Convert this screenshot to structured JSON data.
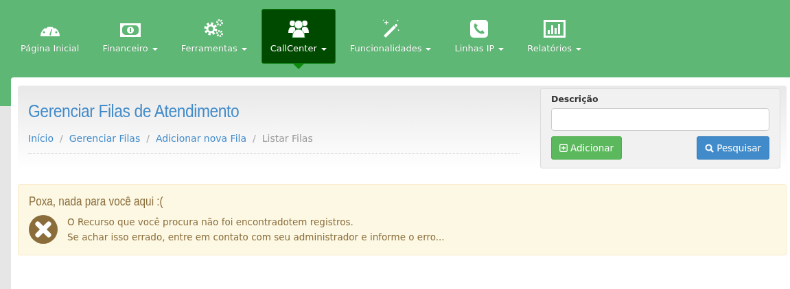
{
  "nav": {
    "items": [
      {
        "label": "Página Inicial",
        "dropdown": false,
        "selected": false
      },
      {
        "label": "Financeiro",
        "dropdown": true,
        "selected": false
      },
      {
        "label": "Ferramentas",
        "dropdown": true,
        "selected": false
      },
      {
        "label": "CallCenter",
        "dropdown": true,
        "selected": true
      },
      {
        "label": "Funcionalidades",
        "dropdown": true,
        "selected": false
      },
      {
        "label": "Linhas IP",
        "dropdown": true,
        "selected": false
      },
      {
        "label": "Relatórios",
        "dropdown": true,
        "selected": false
      }
    ]
  },
  "page": {
    "title": "Gerenciar Filas de Atendimento",
    "breadcrumb": [
      {
        "label": "Início",
        "current": false
      },
      {
        "separator": "/",
        "label": "Gerenciar Filas",
        "current": false
      },
      {
        "separator": "/",
        "label": "Adicionar nova Fila",
        "current": false
      },
      {
        "separator": "/",
        "label": "Listar Filas",
        "current": true
      }
    ]
  },
  "search": {
    "label": "Descrição",
    "buttons": [
      {
        "label": "Adicionar",
        "kind": "add"
      },
      {
        "label": "Pesquisar",
        "kind": "search"
      }
    ]
  },
  "alert": {
    "title": "Poxa, nada para você aqui :(",
    "lines": [
      "O Recurso que você procura não foi encontradotem registros.",
      "Se achar isso errado, entre em contato com seu administrador e informe o erro..."
    ]
  }
}
